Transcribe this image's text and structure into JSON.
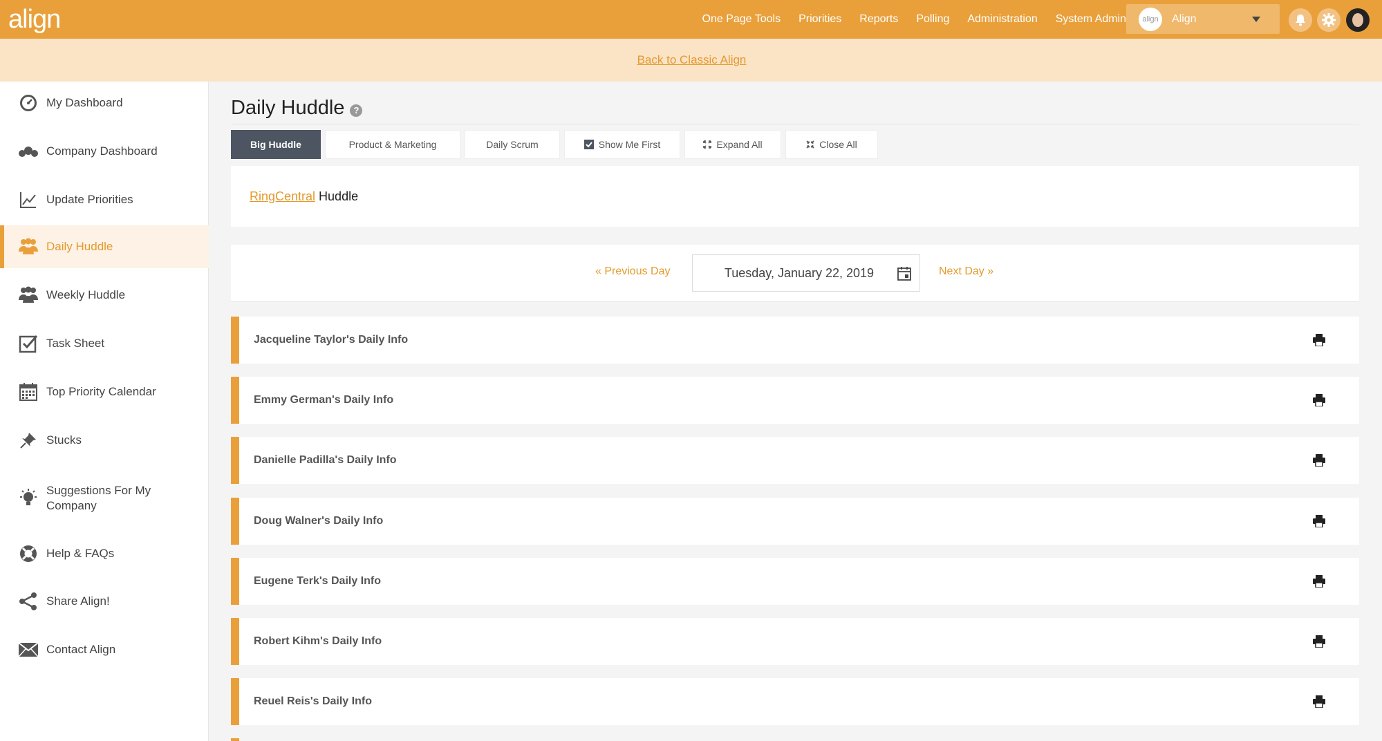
{
  "app": {
    "logo_text": "align",
    "brand_color": "#e9a03b"
  },
  "topnav": {
    "items": [
      "One Page Tools",
      "Priorities",
      "Reports",
      "Polling",
      "Administration",
      "System Admin"
    ],
    "org_logo_text": "align",
    "org_name": "Align",
    "notification_icon": "bell-icon",
    "settings_icon": "gear-icon"
  },
  "banner": {
    "link_text": "Back to Classic Align"
  },
  "sidebar": {
    "items": [
      {
        "label": "My Dashboard",
        "icon": "dashboard-gauge-icon"
      },
      {
        "label": "Company Dashboard",
        "icon": "company-dashboard-icon"
      },
      {
        "label": "Update Priorities",
        "icon": "line-chart-icon"
      },
      {
        "label": "Daily Huddle",
        "icon": "group-icon",
        "active": true
      },
      {
        "label": "Weekly Huddle",
        "icon": "weekly-group-icon"
      },
      {
        "label": "Task Sheet",
        "icon": "checkbox-icon"
      },
      {
        "label": "Top Priority Calendar",
        "icon": "calendar-icon"
      },
      {
        "label": "Stucks",
        "icon": "pushpin-icon"
      },
      {
        "label": "Suggestions For My Company",
        "icon": "lightbulb-icon"
      },
      {
        "label": "Help & FAQs",
        "icon": "lifebuoy-icon"
      },
      {
        "label": "Share Align!",
        "icon": "share-icon"
      },
      {
        "label": "Contact Align",
        "icon": "envelope-icon"
      }
    ]
  },
  "page": {
    "title": "Daily Huddle",
    "help_glyph": "?"
  },
  "tabs": [
    {
      "label": "Big Huddle",
      "active": true
    },
    {
      "label": "Product & Marketing"
    },
    {
      "label": "Daily Scrum"
    },
    {
      "label": "Show Me First",
      "icon": "checkbox-checked-icon"
    },
    {
      "label": "Expand All",
      "icon": "expand-icon"
    },
    {
      "label": "Close All",
      "icon": "collapse-icon"
    }
  ],
  "huddle": {
    "company_link": "RingCentral",
    "suffix": "Huddle"
  },
  "date_nav": {
    "prev_label": "« Previous Day",
    "date_value": "Tuesday, January 22, 2019",
    "next_label": "Next Day »"
  },
  "daily_info": [
    "Jacqueline Taylor's Daily Info",
    "Emmy German's Daily Info",
    "Danielle Padilla's Daily Info",
    "Doug Walner's Daily Info",
    "Eugene Terk's Daily Info",
    "Robert Kihm's Daily Info",
    "Reuel Reis's Daily Info"
  ]
}
